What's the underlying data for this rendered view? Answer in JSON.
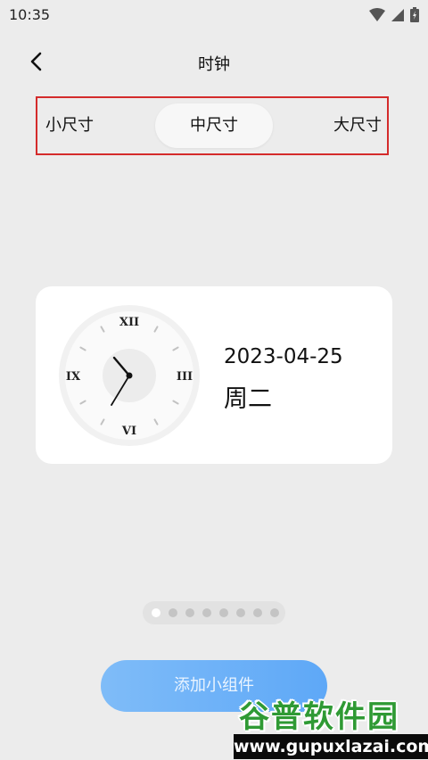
{
  "status_bar": {
    "time": "10:35",
    "icons": [
      "wifi-icon",
      "signal-icon",
      "battery-icon"
    ]
  },
  "header": {
    "title": "时钟",
    "back_icon": "chevron-left-icon"
  },
  "size_tabs": {
    "items": [
      "小尺寸",
      "中尺寸",
      "大尺寸"
    ],
    "selected": "中尺寸",
    "highlight_color": "#d42b2b"
  },
  "widget": {
    "date": "2023-04-25",
    "weekday": "周二",
    "clock": {
      "numerals": [
        "XII",
        "III",
        "VI",
        "IX"
      ],
      "time": "10:35"
    }
  },
  "pagination": {
    "count": 8,
    "active_index": 0
  },
  "add_button": {
    "label": "添加小组件",
    "color": "#6aaef7"
  },
  "watermark": {
    "title": "谷普软件园",
    "url": "www.gupuxlazai.com"
  }
}
